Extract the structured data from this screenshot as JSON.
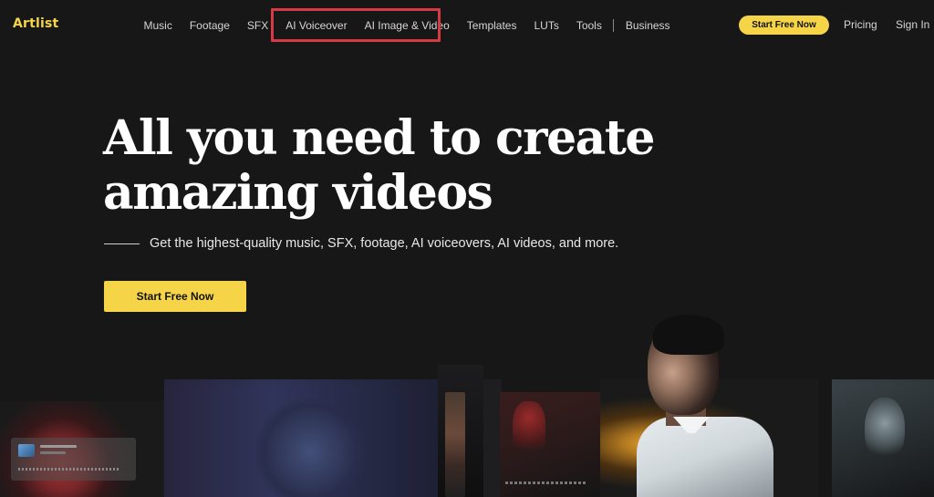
{
  "brand": {
    "logo_text": "Artlist",
    "accent_color": "#f5d547",
    "highlight_color": "#d63b44"
  },
  "nav": {
    "links": [
      {
        "label": "Music"
      },
      {
        "label": "Footage"
      },
      {
        "label": "SFX"
      },
      {
        "label": "AI Voiceover"
      },
      {
        "label": "AI Image & Video"
      },
      {
        "label": "Templates"
      },
      {
        "label": "LUTs"
      },
      {
        "label": "Tools"
      },
      {
        "label": "Business"
      }
    ],
    "cta_label": "Start Free Now",
    "pricing_label": "Pricing",
    "signin_label": "Sign In"
  },
  "hero": {
    "title_line1": "All you need to create",
    "title_line2": "amazing videos",
    "subtitle": "Get the highest-quality music, SFX, footage, AI voiceovers, AI videos, and more.",
    "cta_label": "Start Free Now"
  }
}
